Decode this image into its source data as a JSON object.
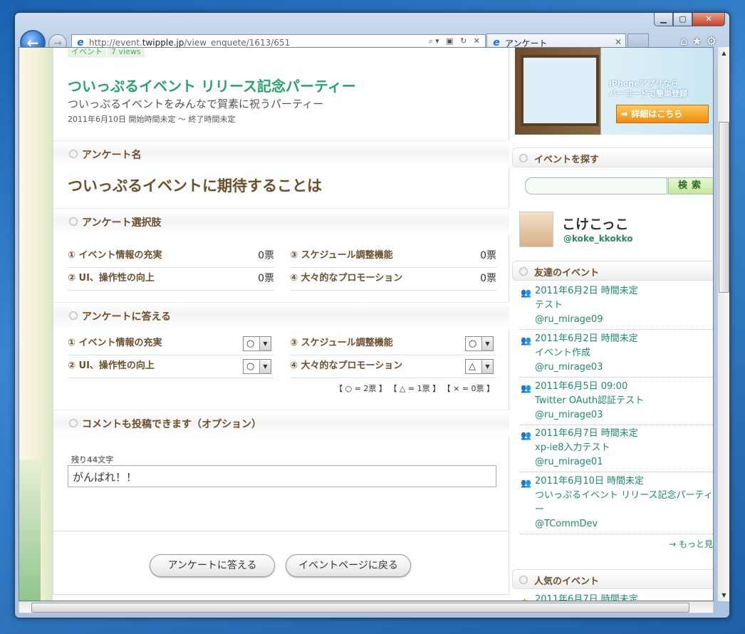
{
  "browser": {
    "url_prefix": "http://event.",
    "url_host": "twipple.jp",
    "url_path": "/view_enquete/1613/651",
    "tab_title": "アンケート"
  },
  "event": {
    "badge": "イベント",
    "views": "7 views",
    "title": "ついっぷるイベント リリース記念パーティー",
    "subtitle": "ついっぷるイベントをみんなで賀素に祝うパーティー",
    "date": "2011年6月10日 開始時間未定 〜 終了時間未定"
  },
  "sections": {
    "name": "アンケート名",
    "choices": "アンケート選択肢",
    "answer": "アンケートに答える",
    "comment": "コメントも投稿できます（オプション）"
  },
  "question": "ついっぷるイベントに期待することは",
  "options": [
    {
      "label": "① イベント情報の充実",
      "votes": "0票",
      "answer": "○"
    },
    {
      "label": "② UI、操作性の向上",
      "votes": "0票",
      "answer": "○"
    },
    {
      "label": "③ スケジュール調整機能",
      "votes": "0票",
      "answer": "○"
    },
    {
      "label": "④ 大々的なプロモーション",
      "votes": "0票",
      "answer": "△"
    }
  ],
  "legend": "【 ○ = 2票 】 【 △ = 1票 】 【 × = 0票 】",
  "comment": {
    "remaining": "残り44文字",
    "value": "がんばれ！！"
  },
  "buttons": {
    "submit": "アンケートに答える",
    "back": "イベントページに戻る"
  },
  "sidebar": {
    "ad_line1": "iPhoneアプリなら",
    "ad_line2": "バーコードで簡単登録",
    "ad_cta": "➡ 詳細はこちら",
    "search_head": "イベントを探す",
    "search_btn": "検索",
    "user_name": "こけこっこ",
    "user_handle": "@koke_kkokko",
    "friends_head": "友達のイベント",
    "friends": [
      {
        "date": "2011年6月2日 時間未定",
        "title": "テスト",
        "user": "@ru_mirage09"
      },
      {
        "date": "2011年6月2日 時間未定",
        "title": "イベント作成",
        "user": "@ru_mirage03"
      },
      {
        "date": "2011年6月5日 09:00",
        "title": "Twitter OAuth認証テスト",
        "user": "@ru_mirage03"
      },
      {
        "date": "2011年6月7日 時間未定",
        "title": "xp-ie8入力テスト",
        "user": "@ru_mirage01"
      },
      {
        "date": "2011年6月10日 時間未定",
        "title": "ついっぷるイベント リリース記念パーティー",
        "user": "@TCommDev"
      }
    ],
    "more": "→ もっと見",
    "popular_head": "人気のイベント",
    "popular": [
      {
        "date": "2011年6月7日 時間未定"
      }
    ]
  }
}
